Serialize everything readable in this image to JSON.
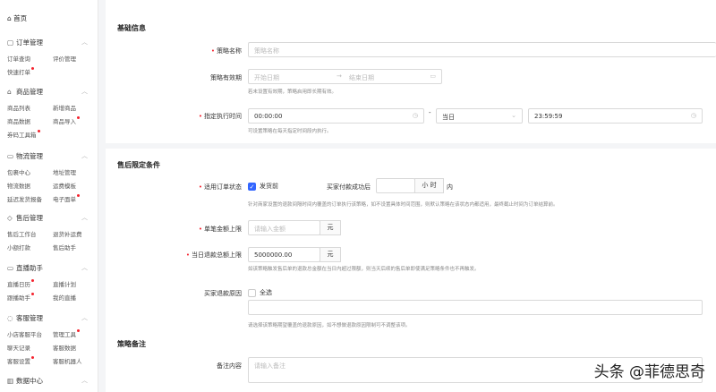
{
  "sidebar": {
    "home": "首页",
    "sections": [
      {
        "title": "订单管理",
        "icon": "order-icon",
        "items": [
          {
            "label": "订单查询",
            "dot": false
          },
          {
            "label": "评价管理",
            "dot": false
          },
          {
            "label": "快速打单",
            "dot": true
          }
        ]
      },
      {
        "title": "商品管理",
        "icon": "bag-icon",
        "items": [
          {
            "label": "商品列表",
            "dot": false
          },
          {
            "label": "新增商品",
            "dot": false
          },
          {
            "label": "商品数据",
            "dot": false
          },
          {
            "label": "商品导入",
            "dot": true
          },
          {
            "label": "券码工具箱",
            "dot": true
          }
        ]
      },
      {
        "title": "物流管理",
        "icon": "truck-icon",
        "items": [
          {
            "label": "包裹中心",
            "dot": false
          },
          {
            "label": "地址管理",
            "dot": false
          },
          {
            "label": "物流数据",
            "dot": false
          },
          {
            "label": "运费模板",
            "dot": false
          },
          {
            "label": "延迟发货报备",
            "dot": false
          },
          {
            "label": "电子面单",
            "dot": true
          }
        ]
      },
      {
        "title": "售后管理",
        "icon": "shield-icon",
        "items": [
          {
            "label": "售后工作台",
            "dot": false
          },
          {
            "label": "退货补运费",
            "dot": false
          },
          {
            "label": "小额打款",
            "dot": false
          },
          {
            "label": "售后助手",
            "dot": false
          }
        ]
      },
      {
        "title": "直播助手",
        "icon": "video-icon",
        "items": [
          {
            "label": "直播日历",
            "dot": true
          },
          {
            "label": "直播计划",
            "dot": false
          },
          {
            "label": "跟播助手",
            "dot": true
          },
          {
            "label": "我的直播",
            "dot": false
          }
        ]
      },
      {
        "title": "客服管理",
        "icon": "chat-icon",
        "items": [
          {
            "label": "小店客服平台",
            "dot": false
          },
          {
            "label": "管理工具",
            "dot": true
          },
          {
            "label": "聊天记录",
            "dot": false
          },
          {
            "label": "客服数据",
            "dot": false
          },
          {
            "label": "客服设置",
            "dot": true
          },
          {
            "label": "客服机器人",
            "dot": false
          }
        ]
      },
      {
        "title": "数据中心",
        "icon": "chart-icon",
        "items": []
      }
    ]
  },
  "basic": {
    "title": "基础信息",
    "name_label": "策略名称",
    "name_placeholder": "策略名称",
    "period_label": "策略有效期",
    "start_placeholder": "开始日期",
    "end_placeholder": "结束日期",
    "period_hint": "若未设置有效期，策略启用即长期有效。",
    "time_label": "指定执行时间",
    "start_time": "00:00:00",
    "dash": "-",
    "day_select": "当日",
    "end_time": "23:59:59",
    "time_hint": "可设置策略在每天指定时间段内执行。"
  },
  "aftersale": {
    "title": "售后限定条件",
    "status_label": "适用订单状态",
    "status_option": "发货前",
    "status_checked": true,
    "pay_label": "买家付款成功后",
    "hours_value": "",
    "hours_unit": "小 时",
    "within": "内",
    "status_hint": "针对商家设置的退款间隔时间内覆盖的订单执行该策略，如不设置具体时间范围，则默认策略在该状态内都适用，最终截止时间为订单结算前。",
    "single_label": "单笔金额上限",
    "single_placeholder": "请输入金额",
    "currency": "元",
    "daily_label": "当日退款总额上限",
    "daily_value": "5000000.00",
    "daily_hint": "如该策略触发售后单的退款总金额在当日内超过限额，则当天后续的售后单即使满足策略条件也不再触发。",
    "reason_label": "买家退款原因",
    "select_all": "全选",
    "select_all_checked": false,
    "reason_hint": "请选择该策略期望覆盖的退款原因，如不想做退款原因限制可不调整该项。"
  },
  "remark": {
    "title": "策略备注",
    "label": "备注内容",
    "placeholder": "请输入备注"
  },
  "watermark": "头条 @菲德思奇",
  "colors": {
    "accent": "#3366ff",
    "required": "#f5222d"
  }
}
